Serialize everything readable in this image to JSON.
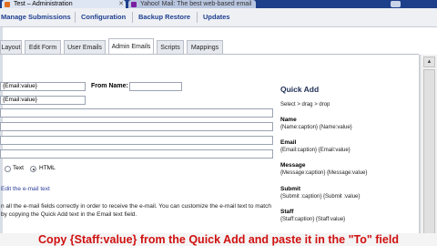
{
  "browser": {
    "tabs": [
      {
        "label": "Test – Administration",
        "active": true
      },
      {
        "label": "Yahoo! Mail: The best web-based email",
        "active": false
      }
    ]
  },
  "admin_nav": {
    "items": [
      "Manage Submissions",
      "Configuration",
      "Backup Restore",
      "Updates"
    ]
  },
  "form_tabs": {
    "items": [
      "Layout",
      "Edit Form",
      "User Emails",
      "Admin Emails",
      "Scripts",
      "Mappings"
    ],
    "active": "Admin Emails"
  },
  "form": {
    "to_value": "{Email:value}",
    "from_name_label": "From Name:",
    "from_name_value": "",
    "from_email_value": "{Email:value}",
    "radio_text_label": "Text",
    "radio_html_label": "HTML",
    "selected_format": "HTML",
    "edit_link": "Edit the e-mail text",
    "help_line1": "n all the e-mail fields correctly in order to receive the e-mail. You can customize the e-mail text to match",
    "help_line2": "by copying the Quick Add text in the Email text field."
  },
  "quick_add": {
    "title": "Quick Add",
    "hint": "Select > drag > drop",
    "fields": [
      {
        "name": "Name",
        "value": "{Name:caption} {Name:value}"
      },
      {
        "name": "Email",
        "value": "{Email:caption} {Email:value}"
      },
      {
        "name": "Message",
        "value": "{Message:caption} {Message:value}"
      },
      {
        "name": "Submit",
        "value": "{Submit :caption} {Submit :value}"
      },
      {
        "name": "Staff",
        "value": "{Staff:caption} {Staff:value}"
      }
    ]
  },
  "caption": "Copy {Staff:value} from the Quick Add and paste it in the \"To\" field"
}
